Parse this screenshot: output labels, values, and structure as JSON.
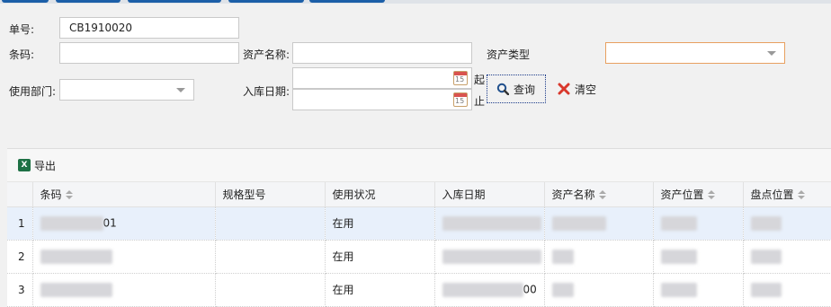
{
  "colors": {
    "accent": "#1c5fa8",
    "highlight_border": "#e8a060",
    "selected_row": "#e8f0fb"
  },
  "form": {
    "order_no_label": "单号:",
    "order_no_value": "CB1910020",
    "barcode_label": "条码:",
    "barcode_value": "",
    "asset_name_label": "资产名称:",
    "asset_name_value": "",
    "asset_type_label": "资产类型",
    "asset_type_value": "",
    "dept_label": "使用部门:",
    "dept_value": "",
    "date_label": "入库日期:",
    "date_from": "",
    "date_to": "",
    "date_from_suffix": "起",
    "date_to_suffix": "止",
    "calendar_day": "15"
  },
  "buttons": {
    "search": "查询",
    "clear": "清空",
    "export": "导出"
  },
  "grid": {
    "columns": [
      "条码",
      "规格型号",
      "使用状况",
      "入库日期",
      "资产名称",
      "资产位置",
      "盘点位置"
    ],
    "rows": [
      {
        "no": "1",
        "barcode_tail": "01",
        "status": "在用",
        "date_tail": "",
        "loc_head": "",
        "selected": true
      },
      {
        "no": "2",
        "barcode_tail": "",
        "status": "在用",
        "date_tail": "",
        "loc_head": "",
        "selected": false
      },
      {
        "no": "3",
        "barcode_tail": "",
        "status": "在用",
        "date_tail": "00",
        "loc_head": "",
        "selected": false
      }
    ]
  }
}
